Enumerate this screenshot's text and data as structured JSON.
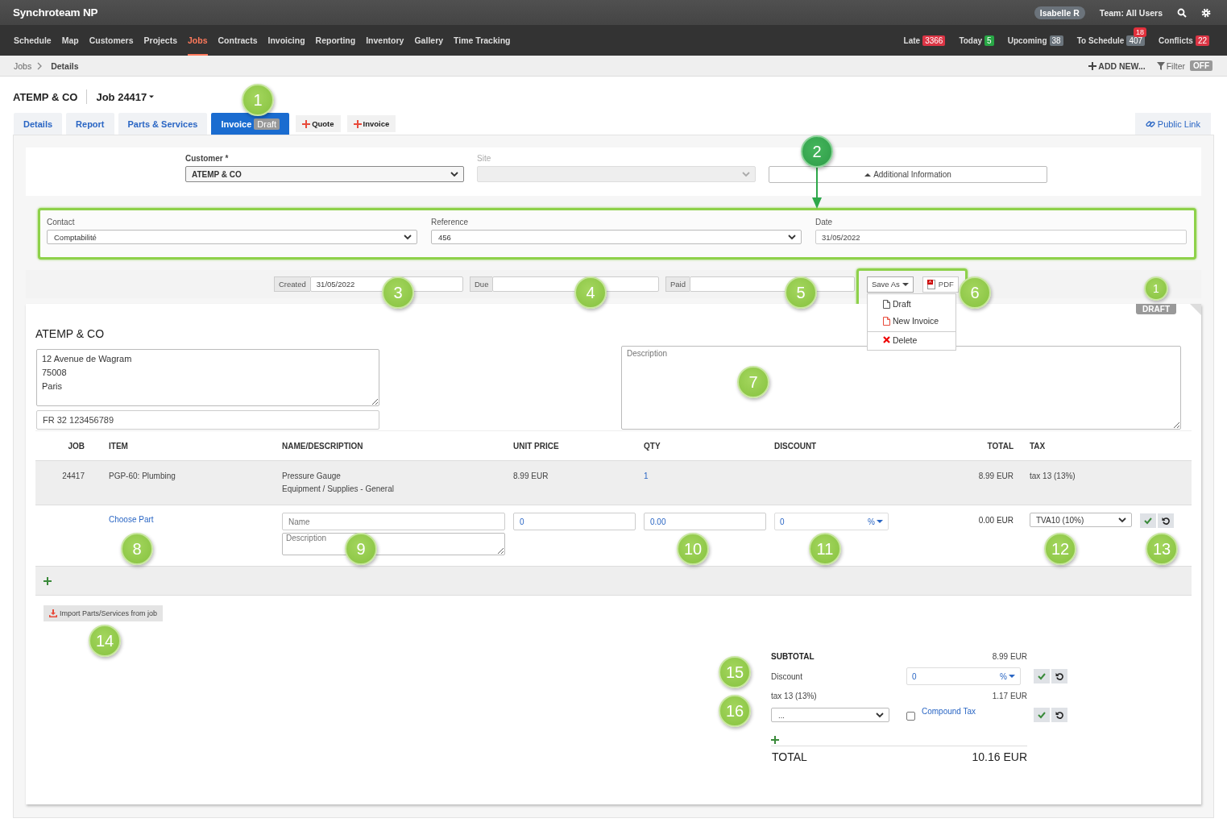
{
  "app": {
    "title": "Synchroteam NP",
    "user": "Isabelle R",
    "team": "Team: All Users"
  },
  "nav": [
    {
      "label": "Schedule",
      "selected": false
    },
    {
      "label": "Map",
      "selected": false
    },
    {
      "label": "Customers",
      "selected": false
    },
    {
      "label": "Projects",
      "selected": false
    },
    {
      "label": "Jobs",
      "selected": true
    },
    {
      "label": "Contracts",
      "selected": false
    },
    {
      "label": "Invoicing",
      "selected": false
    },
    {
      "label": "Reporting",
      "selected": false
    },
    {
      "label": "Inventory",
      "selected": false
    },
    {
      "label": "Gallery",
      "selected": false
    },
    {
      "label": "Time Tracking",
      "selected": false
    }
  ],
  "counters": [
    {
      "label": "Late",
      "count": "3366",
      "color": "#dc3545"
    },
    {
      "label": "Today",
      "count": "5",
      "color": "#28a745"
    },
    {
      "label": "Upcoming",
      "count": "38",
      "color": "#6c757d"
    },
    {
      "label": "To Schedule",
      "count": "407",
      "color": "#6c757d",
      "alert": "18"
    },
    {
      "label": "Conflicts",
      "count": "22",
      "color": "#dc3545"
    }
  ],
  "breadcrumb": [
    "Jobs",
    "Details"
  ],
  "toolbar": {
    "add_new": "ADD NEW...",
    "filter": "Filter",
    "filter_state": "OFF"
  },
  "job_header": {
    "customer": "ATEMP & CO",
    "job": "Job 24417"
  },
  "tabs": [
    {
      "label": "Details",
      "selected": false
    },
    {
      "label": "Report",
      "selected": false
    },
    {
      "label": "Parts & Services",
      "selected": false
    },
    {
      "label": "Invoice",
      "badge": "Draft",
      "selected": true
    }
  ],
  "add_buttons": [
    "Quote",
    "Invoice"
  ],
  "public_link": "Public Link",
  "customer_row": {
    "customer_label": "Customer *",
    "customer": "ATEMP & CO",
    "site_label": "Site",
    "site_disabled": true,
    "additional_info": "Additional Information"
  },
  "contact_panel": {
    "highlighted": true,
    "fields": [
      {
        "label": "Contact",
        "value": "Comptabilité",
        "kind": "select"
      },
      {
        "label": "Reference",
        "value": "456",
        "kind": "select"
      },
      {
        "label": "Date",
        "value": "31/05/2022",
        "kind": "input"
      }
    ]
  },
  "dates": [
    {
      "label": "Created",
      "value": "31/05/2022"
    },
    {
      "label": "Due"
    },
    {
      "label": "Paid"
    }
  ],
  "save_panel": {
    "highlighted": true,
    "save_as": "Save As",
    "pdf": "PDF",
    "menu": [
      {
        "label": "Draft",
        "kind": "file"
      },
      {
        "label": "New Invoice",
        "kind": "file-new"
      },
      {
        "label": "Delete",
        "kind": "delete"
      }
    ]
  },
  "status_stamp": "DRAFT",
  "billing": {
    "name": "ATEMP & CO",
    "address": "12 Avenue de Wagram\n75008\nParis",
    "vat": "FR 32 123456789",
    "description_placeholder": "Description"
  },
  "table": {
    "columns": [
      "JOB",
      "ITEM",
      "NAME/DESCRIPTION",
      "UNIT PRICE",
      "QTY",
      "DISCOUNT",
      "TOTAL",
      "TAX"
    ],
    "rows": [
      {
        "job": "24417",
        "item": "PGP-60: Plumbing",
        "name": "Pressure Gauge",
        "description": "Equipment / Supplies - General",
        "unit_price": "8.99 EUR",
        "qty": "1",
        "total": "8.99 EUR",
        "tax": "tax 13 (13%)"
      }
    ],
    "new_line": {
      "choose_part": "Choose Part",
      "name_placeholder": "Name",
      "description_placeholder": "Description",
      "unit_price": "0",
      "qty": "0.00",
      "discount": "0",
      "discount_unit": "%",
      "total": "0.00 EUR",
      "tax": "TVA10 (10%)"
    }
  },
  "import_button": "Import Parts/Services from job",
  "totals": {
    "subtotal_label": "SUBTOTAL",
    "subtotal": "8.99 EUR",
    "discount_label": "Discount",
    "discount": "0",
    "discount_unit": "%",
    "tax_label": "tax 13 (13%)",
    "tax": "1.17 EUR",
    "tax_select": "...",
    "compound_label": "Compound Tax",
    "compound_checked": false,
    "total_label": "TOTAL",
    "total": "10.16 EUR"
  },
  "callouts": [
    {
      "number": "1",
      "kind": "large"
    },
    {
      "number": "2",
      "kind": "pointer"
    },
    {
      "number": "3",
      "kind": "large"
    },
    {
      "number": "4",
      "kind": "large"
    },
    {
      "number": "5",
      "kind": "large"
    },
    {
      "number": "6",
      "kind": "large"
    },
    {
      "number": "1",
      "kind": "small"
    },
    {
      "number": "7",
      "kind": "large"
    },
    {
      "number": "8",
      "kind": "large"
    },
    {
      "number": "9",
      "kind": "large"
    },
    {
      "number": "10",
      "kind": "large"
    },
    {
      "number": "11",
      "kind": "large"
    },
    {
      "number": "12",
      "kind": "large"
    },
    {
      "number": "13",
      "kind": "large"
    },
    {
      "number": "14",
      "kind": "large"
    },
    {
      "number": "15",
      "kind": "large"
    },
    {
      "number": "16",
      "kind": "large"
    }
  ]
}
